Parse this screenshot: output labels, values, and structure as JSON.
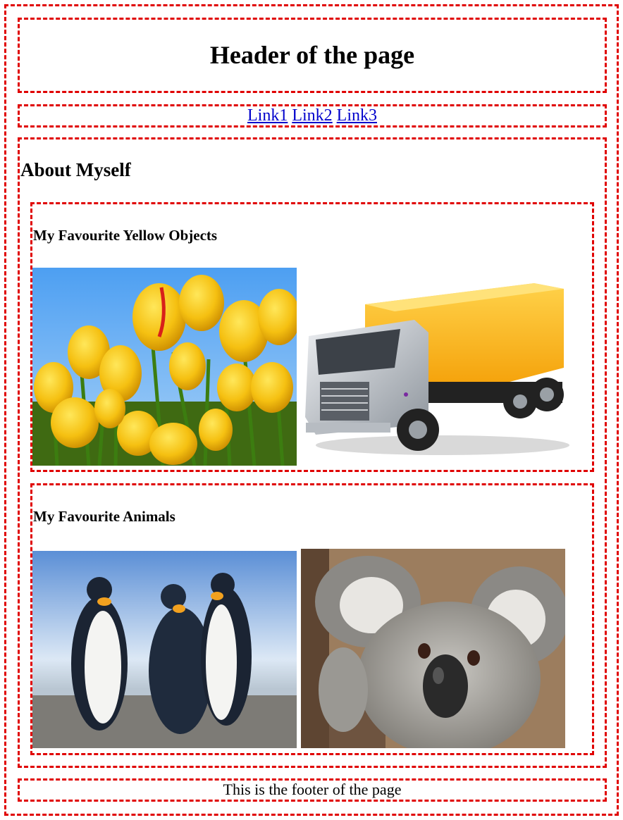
{
  "header": {
    "title": "Header of the page"
  },
  "nav": {
    "links": [
      "Link1",
      "Link2",
      "Link3"
    ]
  },
  "main": {
    "title": "About Myself",
    "sections": [
      {
        "title": "My Favourite Yellow Objects",
        "images": [
          "tulips-image",
          "truck-image"
        ]
      },
      {
        "title": "My Favourite Animals",
        "images": [
          "penguins-image",
          "koala-image"
        ]
      }
    ]
  },
  "footer": {
    "text": "This is the footer of the page"
  },
  "colors": {
    "border": "#e00000",
    "link": "#0000cc"
  }
}
